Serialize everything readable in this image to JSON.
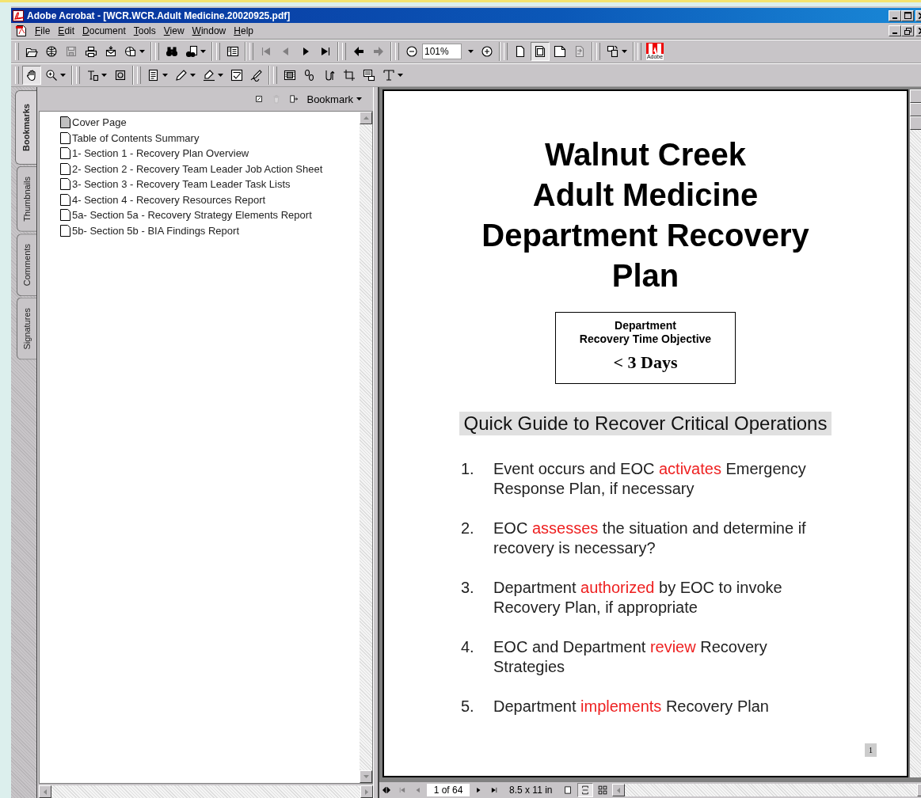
{
  "window": {
    "title": "Adobe Acrobat - [WCR.WCR.Adult Medicine.20020925.pdf]"
  },
  "menu": [
    "File",
    "Edit",
    "Document",
    "Tools",
    "View",
    "Window",
    "Help"
  ],
  "toolbars": [
    [
      {
        "kind": "button",
        "disabled": false,
        "selected": false,
        "menu": false
      },
      {
        "kind": "button",
        "disabled": false,
        "selected": false,
        "menu": false
      },
      {
        "kind": "button",
        "disabled": true,
        "selected": false,
        "menu": false
      },
      {
        "kind": "button",
        "disabled": false,
        "selected": false,
        "menu": false
      },
      {
        "kind": "button",
        "disabled": false,
        "selected": false,
        "menu": false
      },
      {
        "kind": "button",
        "disabled": false,
        "selected": false,
        "menu": true
      },
      {
        "kind": "separator"
      },
      {
        "kind": "button",
        "disabled": false,
        "selected": false,
        "menu": false
      },
      {
        "kind": "button",
        "disabled": false,
        "selected": false,
        "menu": true
      },
      {
        "kind": "separator"
      },
      {
        "kind": "button",
        "disabled": false,
        "selected": false,
        "menu": false
      },
      {
        "kind": "separator"
      },
      {
        "kind": "button",
        "disabled": true,
        "selected": false,
        "menu": false
      },
      {
        "kind": "button",
        "disabled": true,
        "selected": false,
        "menu": false
      },
      {
        "kind": "button",
        "disabled": false,
        "selected": false,
        "menu": false
      },
      {
        "kind": "button",
        "disabled": false,
        "selected": false,
        "menu": false
      },
      {
        "kind": "separator"
      },
      {
        "kind": "button",
        "disabled": false,
        "selected": false,
        "menu": false
      },
      {
        "kind": "button",
        "disabled": true,
        "selected": false,
        "menu": false
      },
      {
        "kind": "separator"
      },
      {
        "kind": "button",
        "disabled": false,
        "selected": false,
        "menu": false
      },
      {
        "kind": "zoom",
        "value": "101%"
      },
      {
        "kind": "button",
        "disabled": false,
        "selected": false,
        "menu": false
      },
      {
        "kind": "separator"
      },
      {
        "kind": "button",
        "disabled": false,
        "selected": false,
        "menu": false
      },
      {
        "kind": "button",
        "disabled": false,
        "selected": true,
        "menu": false
      },
      {
        "kind": "button",
        "disabled": false,
        "selected": false,
        "menu": false
      },
      {
        "kind": "button",
        "disabled": true,
        "selected": false,
        "menu": false
      },
      {
        "kind": "separator"
      },
      {
        "kind": "button",
        "disabled": false,
        "selected": false,
        "menu": true
      },
      {
        "kind": "separator"
      },
      {
        "kind": "logo",
        "text": "Adobe"
      }
    ],
    [
      {
        "kind": "button",
        "disabled": false,
        "selected": true,
        "menu": false
      },
      {
        "kind": "button",
        "disabled": false,
        "selected": false,
        "menu": true
      },
      {
        "kind": "separator"
      },
      {
        "kind": "button",
        "disabled": false,
        "selected": false,
        "menu": true
      },
      {
        "kind": "button",
        "disabled": false,
        "selected": false,
        "menu": false
      },
      {
        "kind": "separator"
      },
      {
        "kind": "button",
        "disabled": false,
        "selected": false,
        "menu": true
      },
      {
        "kind": "button",
        "disabled": false,
        "selected": false,
        "menu": true
      },
      {
        "kind": "button",
        "disabled": false,
        "selected": false,
        "menu": true
      },
      {
        "kind": "button",
        "disabled": false,
        "selected": false,
        "menu": false
      },
      {
        "kind": "button",
        "disabled": false,
        "selected": false,
        "menu": false
      },
      {
        "kind": "separator"
      },
      {
        "kind": "button",
        "disabled": false,
        "selected": false,
        "menu": false
      },
      {
        "kind": "button",
        "disabled": false,
        "selected": false,
        "menu": false
      },
      {
        "kind": "button",
        "disabled": false,
        "selected": false,
        "menu": false
      },
      {
        "kind": "button",
        "disabled": false,
        "selected": false,
        "menu": false
      },
      {
        "kind": "button",
        "disabled": false,
        "selected": false,
        "menu": false
      },
      {
        "kind": "button",
        "disabled": false,
        "selected": false,
        "menu": true
      }
    ]
  ],
  "side_tabs": [
    {
      "label": "Bookmarks",
      "selected": true
    },
    {
      "label": "Thumbnails",
      "selected": false
    },
    {
      "label": "Comments",
      "selected": false
    },
    {
      "label": "Signatures",
      "selected": false
    }
  ],
  "bookmarks_panel": {
    "menu_label": "Bookmark",
    "delete_disabled": true,
    "items": [
      {
        "label": "Cover Page",
        "current": true
      },
      {
        "label": "Table of Contents Summary",
        "current": false
      },
      {
        "label": "1- Section 1 - Recovery Plan Overview",
        "current": false
      },
      {
        "label": "2- Section 2 - Recovery Team Leader Job Action Sheet",
        "current": false
      },
      {
        "label": "3- Section 3 - Recovery Team Leader Task Lists",
        "current": false
      },
      {
        "label": "4- Section 4 - Recovery Resources Report",
        "current": false
      },
      {
        "label": "5a- Section 5a - Recovery Strategy Elements Report",
        "current": false
      },
      {
        "label": "5b- Section 5b - BIA Findings Report",
        "current": false
      }
    ]
  },
  "document": {
    "title_lines": [
      "Walnut Creek",
      "Adult Medicine",
      "Department Recovery",
      "Plan"
    ],
    "objective": {
      "lines": [
        "Department",
        "Recovery Time Objective"
      ],
      "value": "< 3 Days"
    },
    "guide_heading": "Quick Guide to Recover Critical Operations",
    "steps": [
      {
        "number": "1.",
        "parts": [
          {
            "text": "Event occurs and EOC ",
            "highlight": false
          },
          {
            "text": "activates",
            "highlight": true
          },
          {
            "text": " Emergency Response Plan, if necessary",
            "highlight": false
          }
        ]
      },
      {
        "number": "2.",
        "parts": [
          {
            "text": "EOC ",
            "highlight": false
          },
          {
            "text": "assesses",
            "highlight": true
          },
          {
            "text": " the situation and determine if recovery is necessary?",
            "highlight": false
          }
        ]
      },
      {
        "number": "3.",
        "parts": [
          {
            "text": "Department ",
            "highlight": false
          },
          {
            "text": "authorized",
            "highlight": true
          },
          {
            "text": " by EOC to invoke Recovery Plan, if appropriate",
            "highlight": false
          }
        ]
      },
      {
        "number": "4.",
        "parts": [
          {
            "text": "EOC and Department ",
            "highlight": false
          },
          {
            "text": "review",
            "highlight": true
          },
          {
            "text": " Recovery Strategies",
            "highlight": false
          }
        ]
      },
      {
        "number": "5.",
        "parts": [
          {
            "text": "Department ",
            "highlight": false
          },
          {
            "text": "implements",
            "highlight": true
          },
          {
            "text": " Recovery Plan",
            "highlight": false
          }
        ]
      }
    ],
    "page_number": "1"
  },
  "status_bar": {
    "first_disabled": true,
    "prev_disabled": true,
    "page": "1 of 64",
    "page_size": "8.5 x 11 in",
    "layouts": [
      {
        "selected": false
      },
      {
        "selected": true
      },
      {
        "selected": false
      }
    ]
  }
}
